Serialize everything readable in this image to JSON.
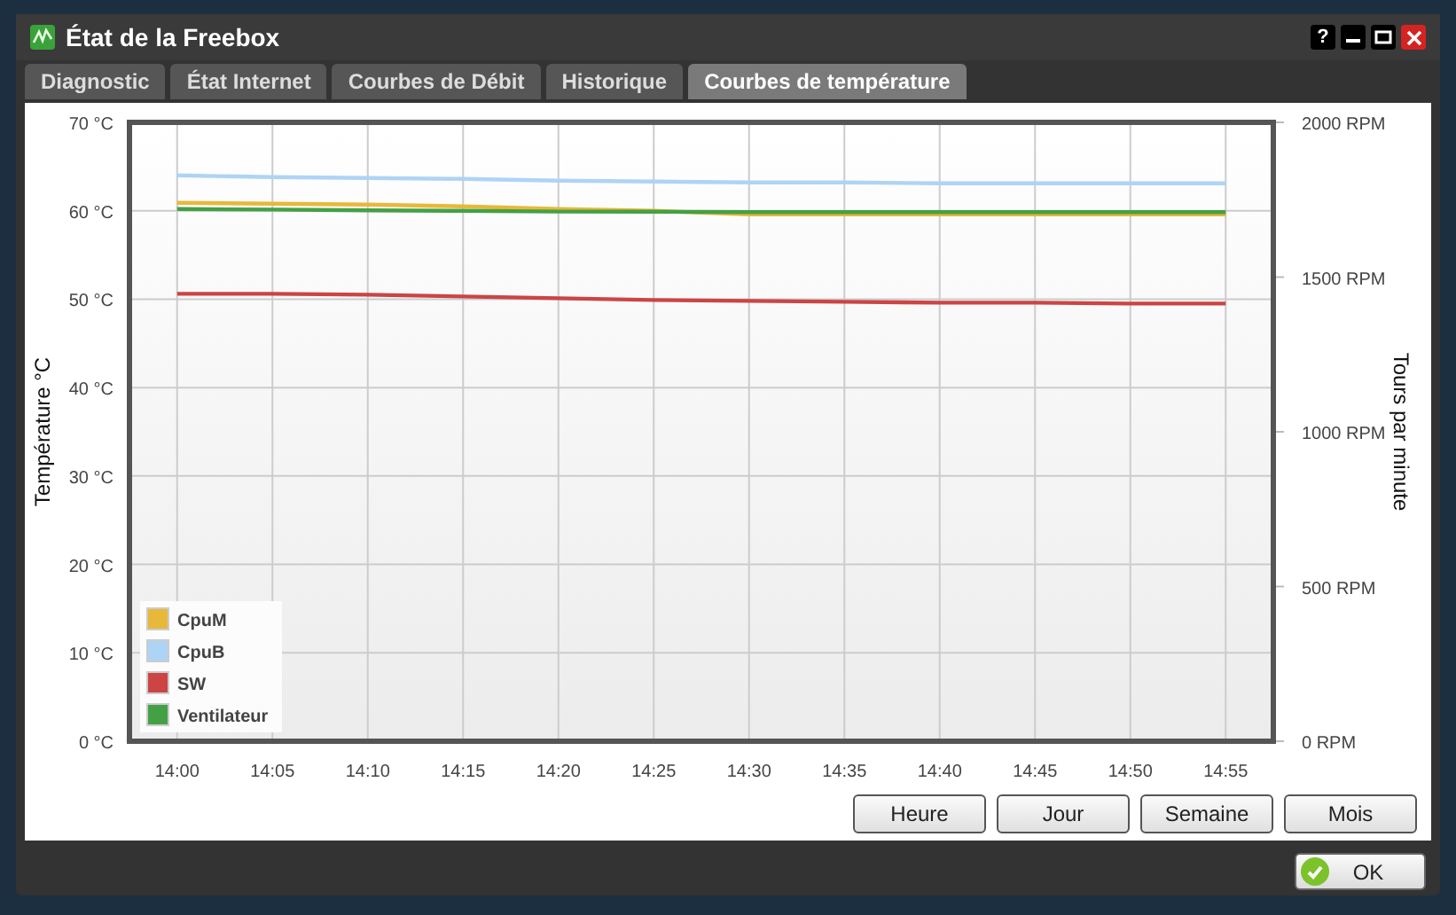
{
  "window": {
    "title": "État de la Freebox",
    "buttons": [
      {
        "kind": "help",
        "label": "?"
      },
      {
        "kind": "minimize"
      },
      {
        "kind": "maximize"
      },
      {
        "kind": "close"
      }
    ]
  },
  "tabs": [
    {
      "label": "Diagnostic",
      "selected": false
    },
    {
      "label": "État Internet",
      "selected": false
    },
    {
      "label": "Courbes de Débit",
      "selected": false
    },
    {
      "label": "Historique",
      "selected": false
    },
    {
      "label": "Courbes de température",
      "selected": true
    }
  ],
  "chart": {
    "chart_data": {
      "type": "line",
      "ylabel": "Température °C",
      "y2label": "Tours par minute",
      "categories": [
        "14:00",
        "14:05",
        "14:10",
        "14:15",
        "14:20",
        "14:25",
        "14:30",
        "14:35",
        "14:40",
        "14:45",
        "14:50",
        "14:55"
      ],
      "ylim": [
        0,
        70
      ],
      "y2lim": [
        0,
        2000
      ],
      "grid": true,
      "legend": true,
      "yticks": [
        {
          "value": 0,
          "label": "0 °C"
        },
        {
          "value": 10,
          "label": "10 °C"
        },
        {
          "value": 20,
          "label": "20 °C"
        },
        {
          "value": 30,
          "label": "30 °C"
        },
        {
          "value": 40,
          "label": "40 °C"
        },
        {
          "value": 50,
          "label": "50 °C"
        },
        {
          "value": 60,
          "label": "60 °C"
        },
        {
          "value": 70,
          "label": "70 °C"
        }
      ],
      "y2ticks": [
        {
          "value": 0,
          "label": "0 RPM"
        },
        {
          "value": 500,
          "label": "500 RPM"
        },
        {
          "value": 1000,
          "label": "1000 RPM"
        },
        {
          "value": 1500,
          "label": "1500 RPM"
        },
        {
          "value": 2000,
          "label": "2000 RPM"
        }
      ],
      "series": [
        {
          "name": "CpuM",
          "color": "#e8b83a",
          "values": [
            60.9,
            60.8,
            60.7,
            60.5,
            60.2,
            60.0,
            59.6,
            59.6,
            59.6,
            59.6,
            59.6,
            59.6
          ]
        },
        {
          "name": "CpuB",
          "color": "#aed4f5",
          "values": [
            64.0,
            63.8,
            63.7,
            63.6,
            63.4,
            63.3,
            63.2,
            63.2,
            63.1,
            63.1,
            63.1,
            63.1
          ]
        },
        {
          "name": "SW",
          "color": "#cc4444",
          "values": [
            50.6,
            50.6,
            50.5,
            50.3,
            50.1,
            49.9,
            49.8,
            49.7,
            49.6,
            49.6,
            49.5,
            49.5
          ]
        },
        {
          "name": "Ventilateur",
          "color": "#44a044",
          "axis": "y2",
          "values": [
            1720,
            1718,
            1716,
            1714,
            1712,
            1711,
            1710,
            1710,
            1710,
            1710,
            1710,
            1710
          ]
        }
      ]
    }
  },
  "range_buttons": [
    "Heure",
    "Jour",
    "Semaine",
    "Mois"
  ],
  "ok_button": "OK"
}
